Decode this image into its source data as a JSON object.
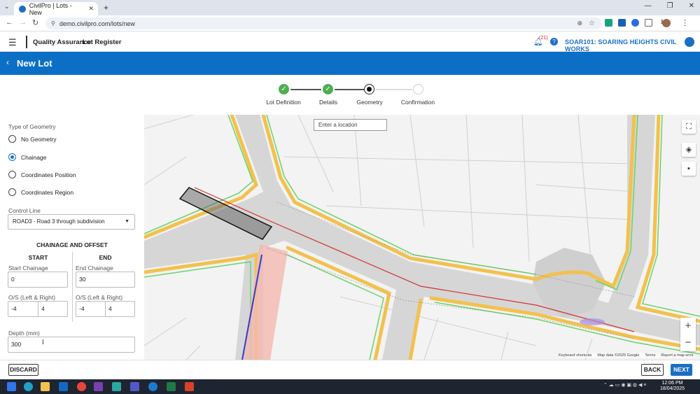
{
  "browser": {
    "tab_title": "CivilPro | Lots - New",
    "tab_close": "✕",
    "new_tab": "+",
    "url": "demo.civilpro.com/lots/new"
  },
  "app": {
    "nav": [
      "Quality Assurance",
      "Lot Register"
    ],
    "notification_count": "(21)",
    "project": "SOAR101: SOARING HEIGHTS CIVIL WORKS"
  },
  "page": {
    "title": "New Lot"
  },
  "stepper": {
    "steps": [
      {
        "label": "Lot Definition",
        "status": "complete"
      },
      {
        "label": "Details",
        "status": "complete"
      },
      {
        "label": "Geometry",
        "status": "current"
      },
      {
        "label": "Confirmation",
        "status": "pending"
      }
    ]
  },
  "form": {
    "type_of_geometry_label": "Type of Geometry",
    "geometry_options": [
      "No Geometry",
      "Chainage",
      "Coordinates Position",
      "Coordinates Region"
    ],
    "selected_geometry": "Chainage",
    "control_line_label": "Control Line",
    "control_line_value": "ROAD3 - Road 3 through subdivision",
    "chainage_offset_heading": "CHAINAGE AND OFFSET",
    "start": {
      "heading": "START",
      "chainage_label": "Start Chainage",
      "chainage_value": "0",
      "offset_label": "O/S (Left & Right)",
      "offset_left": "-4",
      "offset_right": "4"
    },
    "end": {
      "heading": "END",
      "chainage_label": "End Chainage",
      "chainage_value": "30",
      "offset_label": "O/S (Left & Right)",
      "offset_left": "-4",
      "offset_right": "4"
    },
    "depth_label": "Depth (mm)",
    "depth_value": "300"
  },
  "map": {
    "search_placeholder": "Enter a location",
    "attribution": [
      "Keyboard shortcuts",
      "Map data ©2025 Google",
      "Terms",
      "Report a map error"
    ]
  },
  "footer": {
    "discard": "DISCARD",
    "back": "BACK",
    "next": "NEXT"
  },
  "taskbar": {
    "time": "12:06 PM",
    "date": "18/04/2025"
  },
  "colors": {
    "primary": "#0b6fc6",
    "step_complete": "#4caf50",
    "control_line": "#d32f2f"
  }
}
